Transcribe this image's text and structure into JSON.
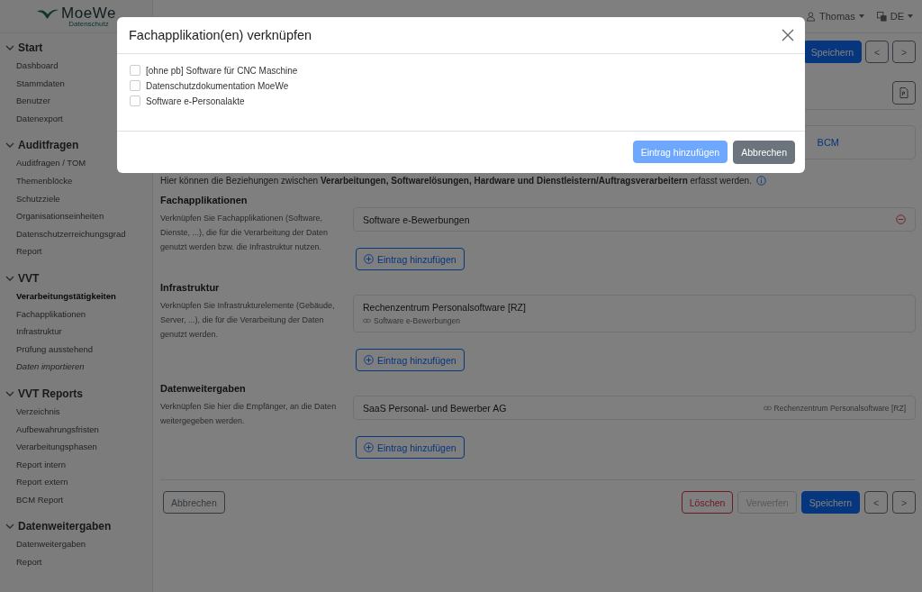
{
  "logo": {
    "name": "MoeWe",
    "tagline": "Datenschutz"
  },
  "topbar": {
    "user": "Thomas",
    "language": "DE"
  },
  "sidebar": {
    "sections": [
      {
        "title": "Start",
        "expanded": true,
        "items": [
          {
            "label": "Dashboard",
            "selected": false,
            "italic": false
          },
          {
            "label": "Stammdaten",
            "selected": false,
            "italic": false
          },
          {
            "label": "Benutzer",
            "selected": false,
            "italic": false
          },
          {
            "label": "Datenexport",
            "selected": false,
            "italic": false
          }
        ]
      },
      {
        "title": "Auditfragen",
        "expanded": true,
        "items": [
          {
            "label": "Auditfragen / TOM",
            "selected": false,
            "italic": false
          },
          {
            "label": "Themenblöcke",
            "selected": false,
            "italic": false
          },
          {
            "label": "Schutzziele",
            "selected": false,
            "italic": false
          },
          {
            "label": "Organisationseinheiten",
            "selected": false,
            "italic": false
          },
          {
            "label": "Datenschutzerreichungsgrad",
            "selected": false,
            "italic": false
          },
          {
            "label": "Report",
            "selected": false,
            "italic": false
          }
        ]
      },
      {
        "title": "VVT",
        "expanded": true,
        "items": [
          {
            "label": "Verarbeitungstätigkeiten",
            "selected": true,
            "italic": false
          },
          {
            "label": "Fachapplikationen",
            "selected": false,
            "italic": false
          },
          {
            "label": "Infrastruktur",
            "selected": false,
            "italic": false
          },
          {
            "label": "Prüfung ausstehend",
            "selected": false,
            "italic": false
          },
          {
            "label": "Daten importieren",
            "selected": false,
            "italic": true
          }
        ]
      },
      {
        "title": "VVT Reports",
        "expanded": true,
        "items": [
          {
            "label": "Verzeichnis",
            "selected": false,
            "italic": false
          },
          {
            "label": "Aufbewahrungsfristen",
            "selected": false,
            "italic": false
          },
          {
            "label": "Verarbeitungsphasen",
            "selected": false,
            "italic": false
          },
          {
            "label": "Report intern",
            "selected": false,
            "italic": false
          },
          {
            "label": "Report extern",
            "selected": false,
            "italic": false
          },
          {
            "label": "BCM Report",
            "selected": false,
            "italic": false
          }
        ]
      },
      {
        "title": "Datenweitergaben",
        "expanded": true,
        "items": [
          {
            "label": "Datenweitergaben",
            "selected": false,
            "italic": false
          },
          {
            "label": "Report",
            "selected": false,
            "italic": false
          }
        ]
      }
    ]
  },
  "toolbar": {
    "buttons": [
      {
        "label": "Speichern",
        "kind": "primary"
      },
      {
        "label": "<",
        "kind": "nav"
      },
      {
        "label": ">",
        "kind": "nav"
      }
    ]
  },
  "tabs": [
    {
      "label": "BCM",
      "selected": false
    }
  ],
  "intro": "Hier können die Beziehungen zwischen **Verarbeitungen, Softwarelösungen, Hardware und Dienstleistern/Auftragsverarbeitern** erfasst werden.",
  "sections": [
    {
      "title": "Fachapplikationen",
      "description": "Verknüpfen Sie Fachapplikationen (Software, Dienste, ...), die für die Verarbeitung der Daten genutzt werden bzw. die Infrastruktur nutzen.",
      "entries": [
        {
          "name": "Software e-Bewerbungen",
          "kind": "removable"
        }
      ],
      "add_label": "Eintrag hinzufügen"
    },
    {
      "title": "Infrastruktur",
      "description": "Verknüpfen Sie Infrastrukturelemente (Gebäude, Server, ...), die für die Verarbeitung der Daten genutzt werden.",
      "entries": [
        {
          "name": "Rechenzentrum Personalsoftware [RZ]",
          "kind": "linked_below",
          "link": "Software e-Bewerbungen"
        }
      ],
      "add_label": "Eintrag hinzufügen"
    },
    {
      "title": "Datenweitergaben",
      "description": "Verknüpfen Sie hier die Empfänger, an die Daten weitergegeben werden.",
      "entries": [
        {
          "name": "SaaS Personal- und Bewerber AG",
          "kind": "linked_right",
          "link": "Rechenzentrum Personalsoftware [RZ]"
        }
      ],
      "add_label": "Eintrag hinzufügen"
    }
  ],
  "footer": {
    "left": [
      {
        "label": "Abbrechen",
        "kind": "outline"
      }
    ],
    "right": [
      {
        "label": "Löschen",
        "kind": "danger"
      },
      {
        "label": "Verwerfen",
        "kind": "disabled"
      },
      {
        "label": "Speichern",
        "kind": "primary"
      },
      {
        "label": "<",
        "kind": "nav"
      },
      {
        "label": ">",
        "kind": "nav"
      }
    ]
  },
  "modal": {
    "title": "Fachapplikation(en) verknüpfen",
    "options": [
      {
        "label": "[ohne pb] Software für CNC Maschine",
        "checked": false
      },
      {
        "label": "Datenschutzdokumentation MoeWe",
        "checked": false
      },
      {
        "label": "Software e-Personalakte",
        "checked": false
      }
    ],
    "buttons": [
      {
        "label": "Eintrag hinzufügen",
        "kind": "primary",
        "disabled": true
      },
      {
        "label": "Abbrechen",
        "kind": "secondary"
      }
    ]
  }
}
